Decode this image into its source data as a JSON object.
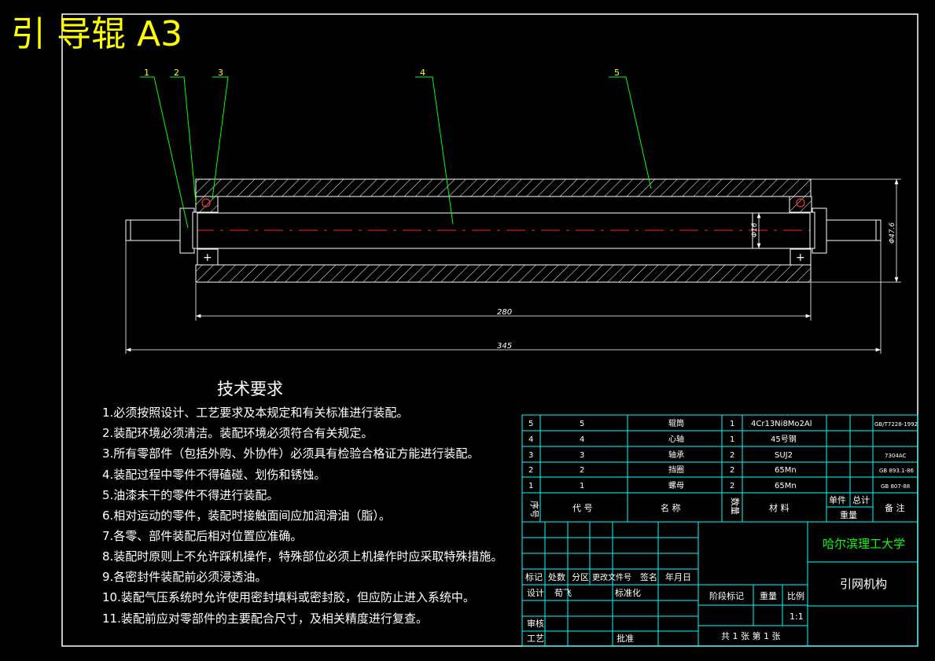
{
  "drawing_title": "引 导辊 A3",
  "balloons": [
    "1",
    "2",
    "3",
    "4",
    "5"
  ],
  "dimensions": {
    "length_body": "280",
    "length_total": "345",
    "dia_shaft": "Φ16",
    "dia_roller": "Φ47.6"
  },
  "tech_req": {
    "heading": "技术要求",
    "items": [
      "1.必须按照设计、工艺要求及本规定和有关标准进行装配。",
      "2.装配环境必须清洁。装配环境必须符合有关规定。",
      "3.所有零部件（包括外购、外协件）必须具有检验合格证方能进行装配。",
      "4.装配过程中零件不得磕碰、划伤和锈蚀。",
      "5.油漆未干的零件不得进行装配。",
      "6.相对运动的零件，装配时接触面间应加润滑油（脂）。",
      "7.各零、部件装配后相对位置应准确。",
      "8.装配时原则上不允许踩机操作，特殊部位必须上机操作时应采取特殊措施。",
      "9.各密封件装配前必须浸透油。",
      "10.装配气压系统时允许使用密封填料或密封胶，但应防止进入系统中。",
      "11.装配前应对零部件的主要配合尺寸，及相关精度进行复查。"
    ]
  },
  "bom": {
    "rows": [
      {
        "seq": "5",
        "code": "5",
        "name": "辊筒",
        "qty": "1",
        "material": "4Cr13Ni8Mo2Al",
        "remark": "GB/T7228-1992"
      },
      {
        "seq": "4",
        "code": "4",
        "name": "心轴",
        "qty": "1",
        "material": "45号钢",
        "remark": ""
      },
      {
        "seq": "3",
        "code": "3",
        "name": "轴承",
        "qty": "2",
        "material": "SUJ2",
        "remark": "7304AC"
      },
      {
        "seq": "2",
        "code": "2",
        "name": "挡圈",
        "qty": "2",
        "material": "65Mn",
        "remark": "GB 893.1-86"
      },
      {
        "seq": "1",
        "code": "1",
        "name": "螺母",
        "qty": "2",
        "material": "65Mn",
        "remark": "GB 807-88"
      }
    ],
    "header": {
      "seq": "序号",
      "code": "代  号",
      "name": "名  称",
      "qty": "数量",
      "material": "材  料",
      "unit_weight": "单件",
      "total_weight": "总计",
      "weight": "重量",
      "remark": "备  注"
    }
  },
  "title_block": {
    "university": "哈尔滨理工大学",
    "part_name": "引网机构",
    "rev_labels": [
      "标记",
      "处数",
      "分区",
      "更改文件号",
      "签名",
      "年月日"
    ],
    "design_label": "设计",
    "designer": "荀飞",
    "standardize_label": "标准化",
    "review_label": "审核",
    "process_label": "工艺",
    "approve_label": "批准",
    "stage_label": "阶段标记",
    "weight_label": "重量",
    "scale_label": "比例",
    "scale_value": "1:1",
    "sheet_info": "共 1 张  第 1 张"
  }
}
